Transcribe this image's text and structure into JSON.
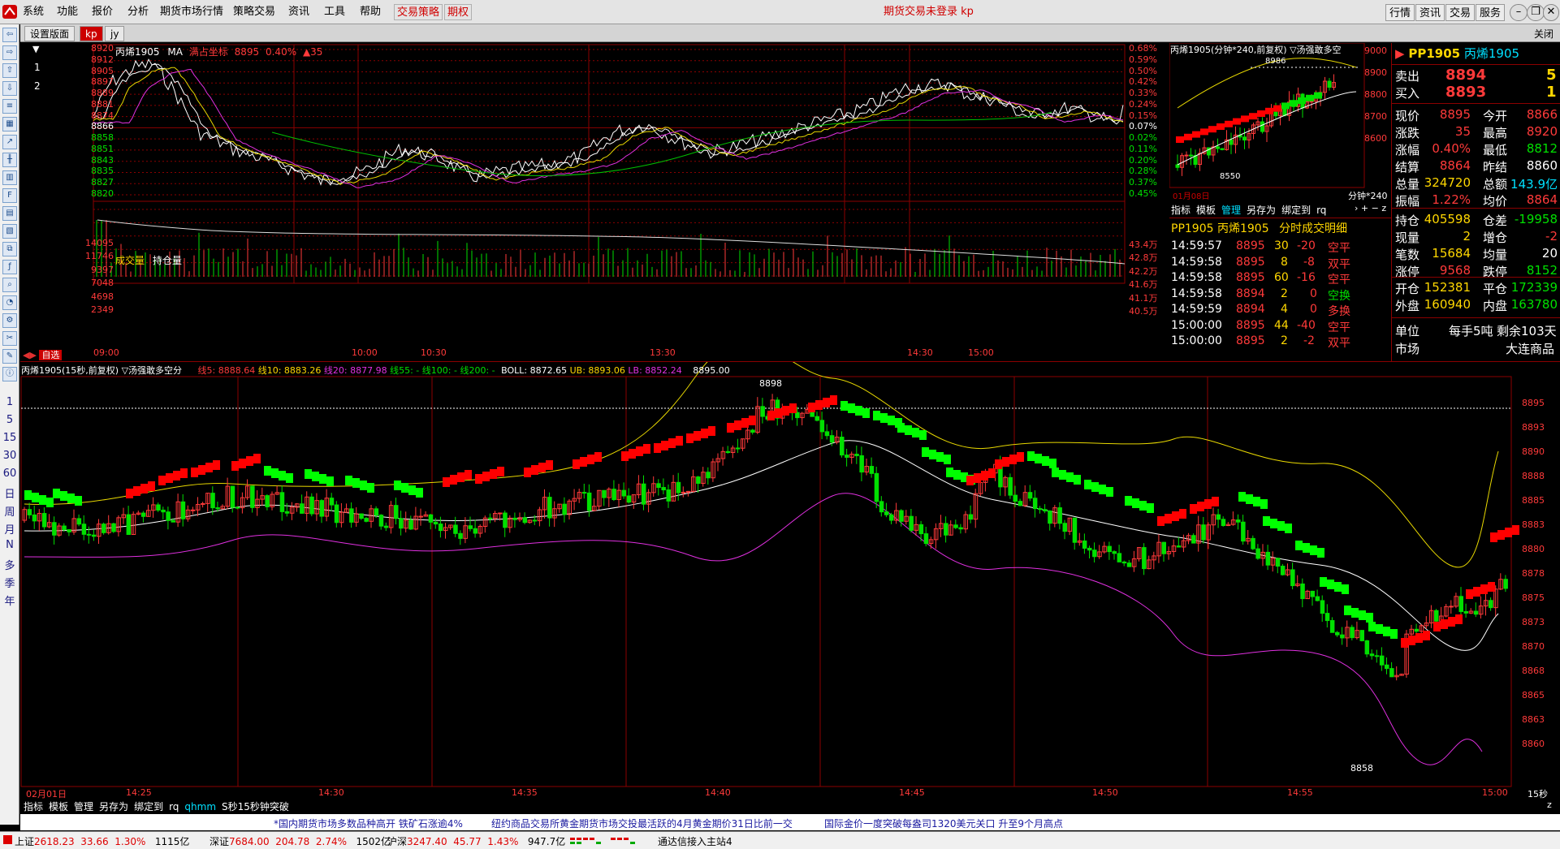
{
  "menu": {
    "items": [
      "系统",
      "功能",
      "报价",
      "分析",
      "期货市场行情",
      "策略交易",
      "资讯",
      "工具",
      "帮助"
    ],
    "strategy_label": "交易策略",
    "options_label": "期权",
    "center_notice": "期货交易未登录  kp",
    "right_buttons": [
      "行情",
      "资讯",
      "交易",
      "服务"
    ]
  },
  "tabs": {
    "items": [
      "设置版面",
      "kp",
      "jy"
    ],
    "close": "关闭"
  },
  "left_strip": {
    "numbers": [
      "1",
      "2"
    ],
    "periods": [
      "1",
      "5",
      "15",
      "30",
      "60",
      "日",
      "周",
      "月",
      "N",
      "多",
      "季",
      "年"
    ]
  },
  "intraday": {
    "header_name": "丙烯1905",
    "header_ma": "MA",
    "header_label": "满占坐标",
    "header_value": "8895",
    "header_pct": "0.40%",
    "header_change": "▲35",
    "price_ticks": [
      "8920",
      "8912",
      "8905",
      "8897",
      "8889",
      "8881",
      "8874",
      "8866",
      "8858",
      "8851",
      "8843",
      "8835",
      "8827",
      "8820"
    ],
    "pct_ticks": [
      "0.68%",
      "0.59%",
      "0.50%",
      "0.42%",
      "0.33%",
      "0.24%",
      "0.15%",
      "0.07%",
      "0.02%",
      "0.11%",
      "0.20%",
      "0.28%",
      "0.37%",
      "0.45%"
    ],
    "vol_label": "成交量",
    "oi_label": "持仓量",
    "vol_ticks": [
      "14095",
      "11746",
      "9397",
      "7048",
      "4698",
      "2349"
    ],
    "oi_ticks": [
      "43.4万",
      "42.8万",
      "42.2万",
      "41.6万",
      "41.1万",
      "40.5万"
    ],
    "time_ticks": [
      "09:00",
      "10:00",
      "10:30",
      "13:30",
      "14:30",
      "15:00"
    ],
    "tab_zixuan": "自选"
  },
  "mini_chart": {
    "header": "丙烯1905(分钟*240,前复权) ▽汤强敢多空",
    "high_mark": "8986",
    "low_mark": "8550",
    "y_ticks": [
      "9000",
      "8900",
      "8800",
      "8700",
      "8600"
    ],
    "date": "01月08日",
    "period": "分钟*240",
    "tools": [
      "指标",
      "模板",
      "管理",
      "另存为",
      "绑定到",
      "rq"
    ]
  },
  "ticks_panel": {
    "title_code": "PP1905",
    "title_name": "丙烯1905",
    "title_suffix": "分时成交明细",
    "rows": [
      {
        "time": "14:59:57",
        "price": "8895",
        "vol": "30",
        "oi": "-20",
        "type": "空平"
      },
      {
        "time": "14:59:58",
        "price": "8895",
        "vol": "8",
        "oi": "-8",
        "type": "双平"
      },
      {
        "time": "14:59:58",
        "price": "8895",
        "vol": "60",
        "oi": "-16",
        "type": "空平"
      },
      {
        "time": "14:59:58",
        "price": "8894",
        "vol": "2",
        "oi": "0",
        "type": "空换"
      },
      {
        "time": "14:59:59",
        "price": "8894",
        "vol": "4",
        "oi": "0",
        "type": "多换"
      },
      {
        "time": "15:00:00",
        "price": "8895",
        "vol": "44",
        "oi": "-40",
        "type": "空平"
      },
      {
        "time": "15:00:00",
        "price": "8895",
        "vol": "2",
        "oi": "-2",
        "type": "双平"
      }
    ]
  },
  "quote": {
    "code": "PP1905",
    "name": "丙烯1905",
    "sell_label": "卖出",
    "sell_price": "8894",
    "sell_vol": "5",
    "buy_label": "买入",
    "buy_price": "8893",
    "buy_vol": "1",
    "rows": [
      {
        "l1": "现价",
        "v1": "8895",
        "l2": "今开",
        "v2": "8866"
      },
      {
        "l1": "涨跌",
        "v1": "35",
        "l2": "最高",
        "v2": "8920"
      },
      {
        "l1": "涨幅",
        "v1": "0.40%",
        "l2": "最低",
        "v2": "8812"
      },
      {
        "l1": "结算",
        "v1": "8864",
        "l2": "昨结",
        "v2": "8860"
      },
      {
        "l1": "总量",
        "v1": "324720",
        "l2": "总额",
        "v2": "143.9亿"
      },
      {
        "l1": "振幅",
        "v1": "1.22%",
        "l2": "均价",
        "v2": "8864"
      }
    ],
    "rows2": [
      {
        "l1": "持仓",
        "v1": "405598",
        "l2": "仓差",
        "v2": "-19958"
      },
      {
        "l1": "现量",
        "v1": "2",
        "l2": "增仓",
        "v2": "-2"
      },
      {
        "l1": "笔数",
        "v1": "15684",
        "l2": "均量",
        "v2": "20"
      },
      {
        "l1": "涨停",
        "v1": "9568",
        "l2": "跌停",
        "v2": "8152"
      }
    ],
    "rows3": [
      {
        "l1": "开仓",
        "v1": "152381",
        "l2": "平仓",
        "v2": "172339"
      },
      {
        "l1": "外盘",
        "v1": "160940",
        "l2": "内盘",
        "v2": "163780"
      }
    ],
    "unit_label": "单位",
    "unit_value": "每手5吨",
    "remain": "剩余103天",
    "market_label": "市场",
    "market_value": "大连商品"
  },
  "kline": {
    "header_name": "丙烯1905(15秒,前复权) ▽汤强敢多空分",
    "ma5": "线5: 8888.64",
    "ma10": "线10: 8883.26",
    "ma20": "线20: 8877.98",
    "ma55": "线55: -",
    "ma100": "线100: -",
    "ma200": "线200: -",
    "boll": "BOLL: 8872.65",
    "ub": "UB: 8893.06",
    "lb": "LB: 8852.24",
    "last": "8895.00",
    "high_mark": "8898",
    "low_mark": "8858",
    "y_ticks": [
      "8895",
      "8893",
      "8890",
      "8888",
      "8885",
      "8883",
      "8880",
      "8878",
      "8875",
      "8873",
      "8870",
      "8868",
      "8865",
      "8863",
      "8860"
    ],
    "x_ticks": [
      "02月01日",
      "14:25",
      "14:30",
      "14:35",
      "14:40",
      "14:45",
      "14:50",
      "14:55",
      "15:00"
    ],
    "period": "15秒",
    "tools": [
      "指标",
      "模板",
      "管理",
      "另存为",
      "绑定到",
      "rq",
      "qhmm",
      "S秒15秒钟突破"
    ]
  },
  "ticker": {
    "items": [
      "*国内期货市场多数品种高开  铁矿石涨逾4%",
      "纽约商品交易所黄金期货市场交投最活跃的4月黄金期价31日比前一交",
      "国际金价一度突破每盎司1320美元关口  升至9个月高点"
    ]
  },
  "status": {
    "sh_label": "上证",
    "sh_val": "2618.23",
    "sh_chg": "33.66",
    "sh_pct": "1.30%",
    "sh_amt": "1115亿",
    "sz_label": "深证",
    "sz_val": "7684.00",
    "sz_chg": "204.78",
    "sz_pct": "2.74%",
    "sz_amt": "1502亿",
    "hs_label": "沪深",
    "hs_val": "3247.40",
    "hs_chg": "45.77",
    "hs_pct": "1.43%",
    "hs_amt": "947.7亿",
    "conn": "通达信接入主站4"
  },
  "colors": {
    "up": "#ff3a3a",
    "down": "#00e000",
    "grid": "#8b0000",
    "ma_white": "#ffffff",
    "ma_yellow": "#e8d800",
    "ma_magenta": "#e030e0",
    "ma_green": "#00c000"
  }
}
